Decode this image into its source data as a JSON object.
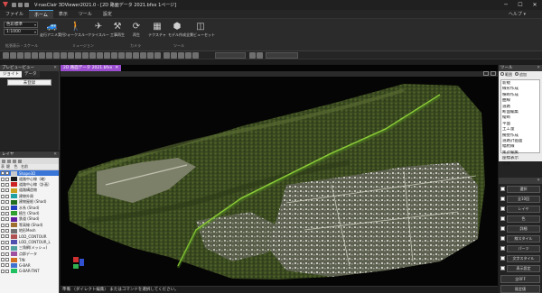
{
  "app": {
    "title": "V-nasClair 3DViewer2021.0 - [2D 路面データ 2021.bfxx 1ページ]"
  },
  "window_controls": {
    "minimize": "─",
    "maximize": "☐",
    "close": "✕"
  },
  "menu": {
    "items": [
      "ファイル",
      "ホーム",
      "表示",
      "ツール",
      "設定"
    ],
    "active_index": 1,
    "help": "ヘルプ ▾"
  },
  "ribbon": {
    "display_mode": "色彩標準",
    "scale_value": "1:1000",
    "tools": [
      {
        "label": "走行アニメ実行",
        "icon": "car-icon"
      },
      {
        "label": "ウォークスルー",
        "icon": "walk-icon"
      },
      {
        "label": "フライスルー",
        "icon": "fly-icon"
      },
      {
        "label": "工事再生",
        "icon": "construction-icon"
      },
      {
        "label": "再生",
        "icon": "play-icon"
      },
      {
        "label": "テクスチャ",
        "icon": "texture-icon"
      },
      {
        "label": "モデル作成",
        "icon": "model-icon"
      },
      {
        "label": "全景ビューセット",
        "icon": "panorama-icon"
      }
    ],
    "groups": [
      "拡張表示・スケール",
      "ミュージョン",
      "カメラ",
      "ツール"
    ]
  },
  "preview": {
    "title": "プレビュービュー",
    "tabs": [
      "ジョイト",
      "データ"
    ],
    "button": "未登録"
  },
  "layers": {
    "title": "レイヤ",
    "columns": [
      "表",
      "鍵",
      "色",
      "名前"
    ],
    "rows": [
      {
        "name": "Shape3D",
        "color": "#c8c8c8",
        "selected": true
      },
      {
        "name": "道路中心線（確）",
        "color": "#1a1a1a"
      },
      {
        "name": "道路中心線（計画）",
        "color": "#cc2222"
      },
      {
        "name": "道路構造物",
        "color": "#c8a020"
      },
      {
        "name": "建物外周",
        "color": "#20a0a0"
      },
      {
        "name": "建物屋根 (Shad)",
        "color": "#207020"
      },
      {
        "name": "水系 (Shad)",
        "color": "#2040c0"
      },
      {
        "name": "植生 (Shad)",
        "color": "#30a030"
      },
      {
        "name": "鉄道 (Shad)",
        "color": "#6020a0"
      },
      {
        "name": "等高線 (Shad)",
        "color": "#a07030"
      },
      {
        "name": "地形Mesh",
        "color": "#707070"
      },
      {
        "name": "LOD_CONTOUR",
        "color": "#b05050"
      },
      {
        "name": "LOD_CONTOUR_L",
        "color": "#5050b0"
      },
      {
        "name": "三角網(メッシュ)",
        "color": "#50a0a0"
      },
      {
        "name": "点群データ",
        "color": "#a050a0"
      },
      {
        "name": "TIN",
        "color": "#d07020"
      },
      {
        "name": "G-BAR",
        "color": "#4070d0"
      },
      {
        "name": "G-BAR-TINT",
        "color": "#20c060"
      }
    ]
  },
  "viewport": {
    "tab_label": "2D 路面データ 2021.bfxx",
    "close": "✕"
  },
  "side": {
    "title": "ツール",
    "radio": [
      {
        "label": "範囲",
        "on": false
      },
      {
        "label": "追加",
        "on": true
      }
    ],
    "list": [
      "新規",
      "線形作成",
      "横断作成",
      "曲線",
      "道路",
      "断面編集",
      "縦断",
      "平面",
      "土工量",
      "擁壁作成",
      "道路計画面",
      "幅杭線",
      "集計編集",
      "座標表示",
      "位置"
    ],
    "buttons": [
      "選択",
      "全10回",
      "レイヤ",
      "色",
      "詳細",
      "線スタイル",
      "パーツ",
      "文字スタイル",
      "表示設定"
    ],
    "extra_buttons": [
      "全OFF",
      "既定値"
    ]
  },
  "status": {
    "text": "準備 （ダイレクト編集） またはコマンドを選択してください。"
  }
}
